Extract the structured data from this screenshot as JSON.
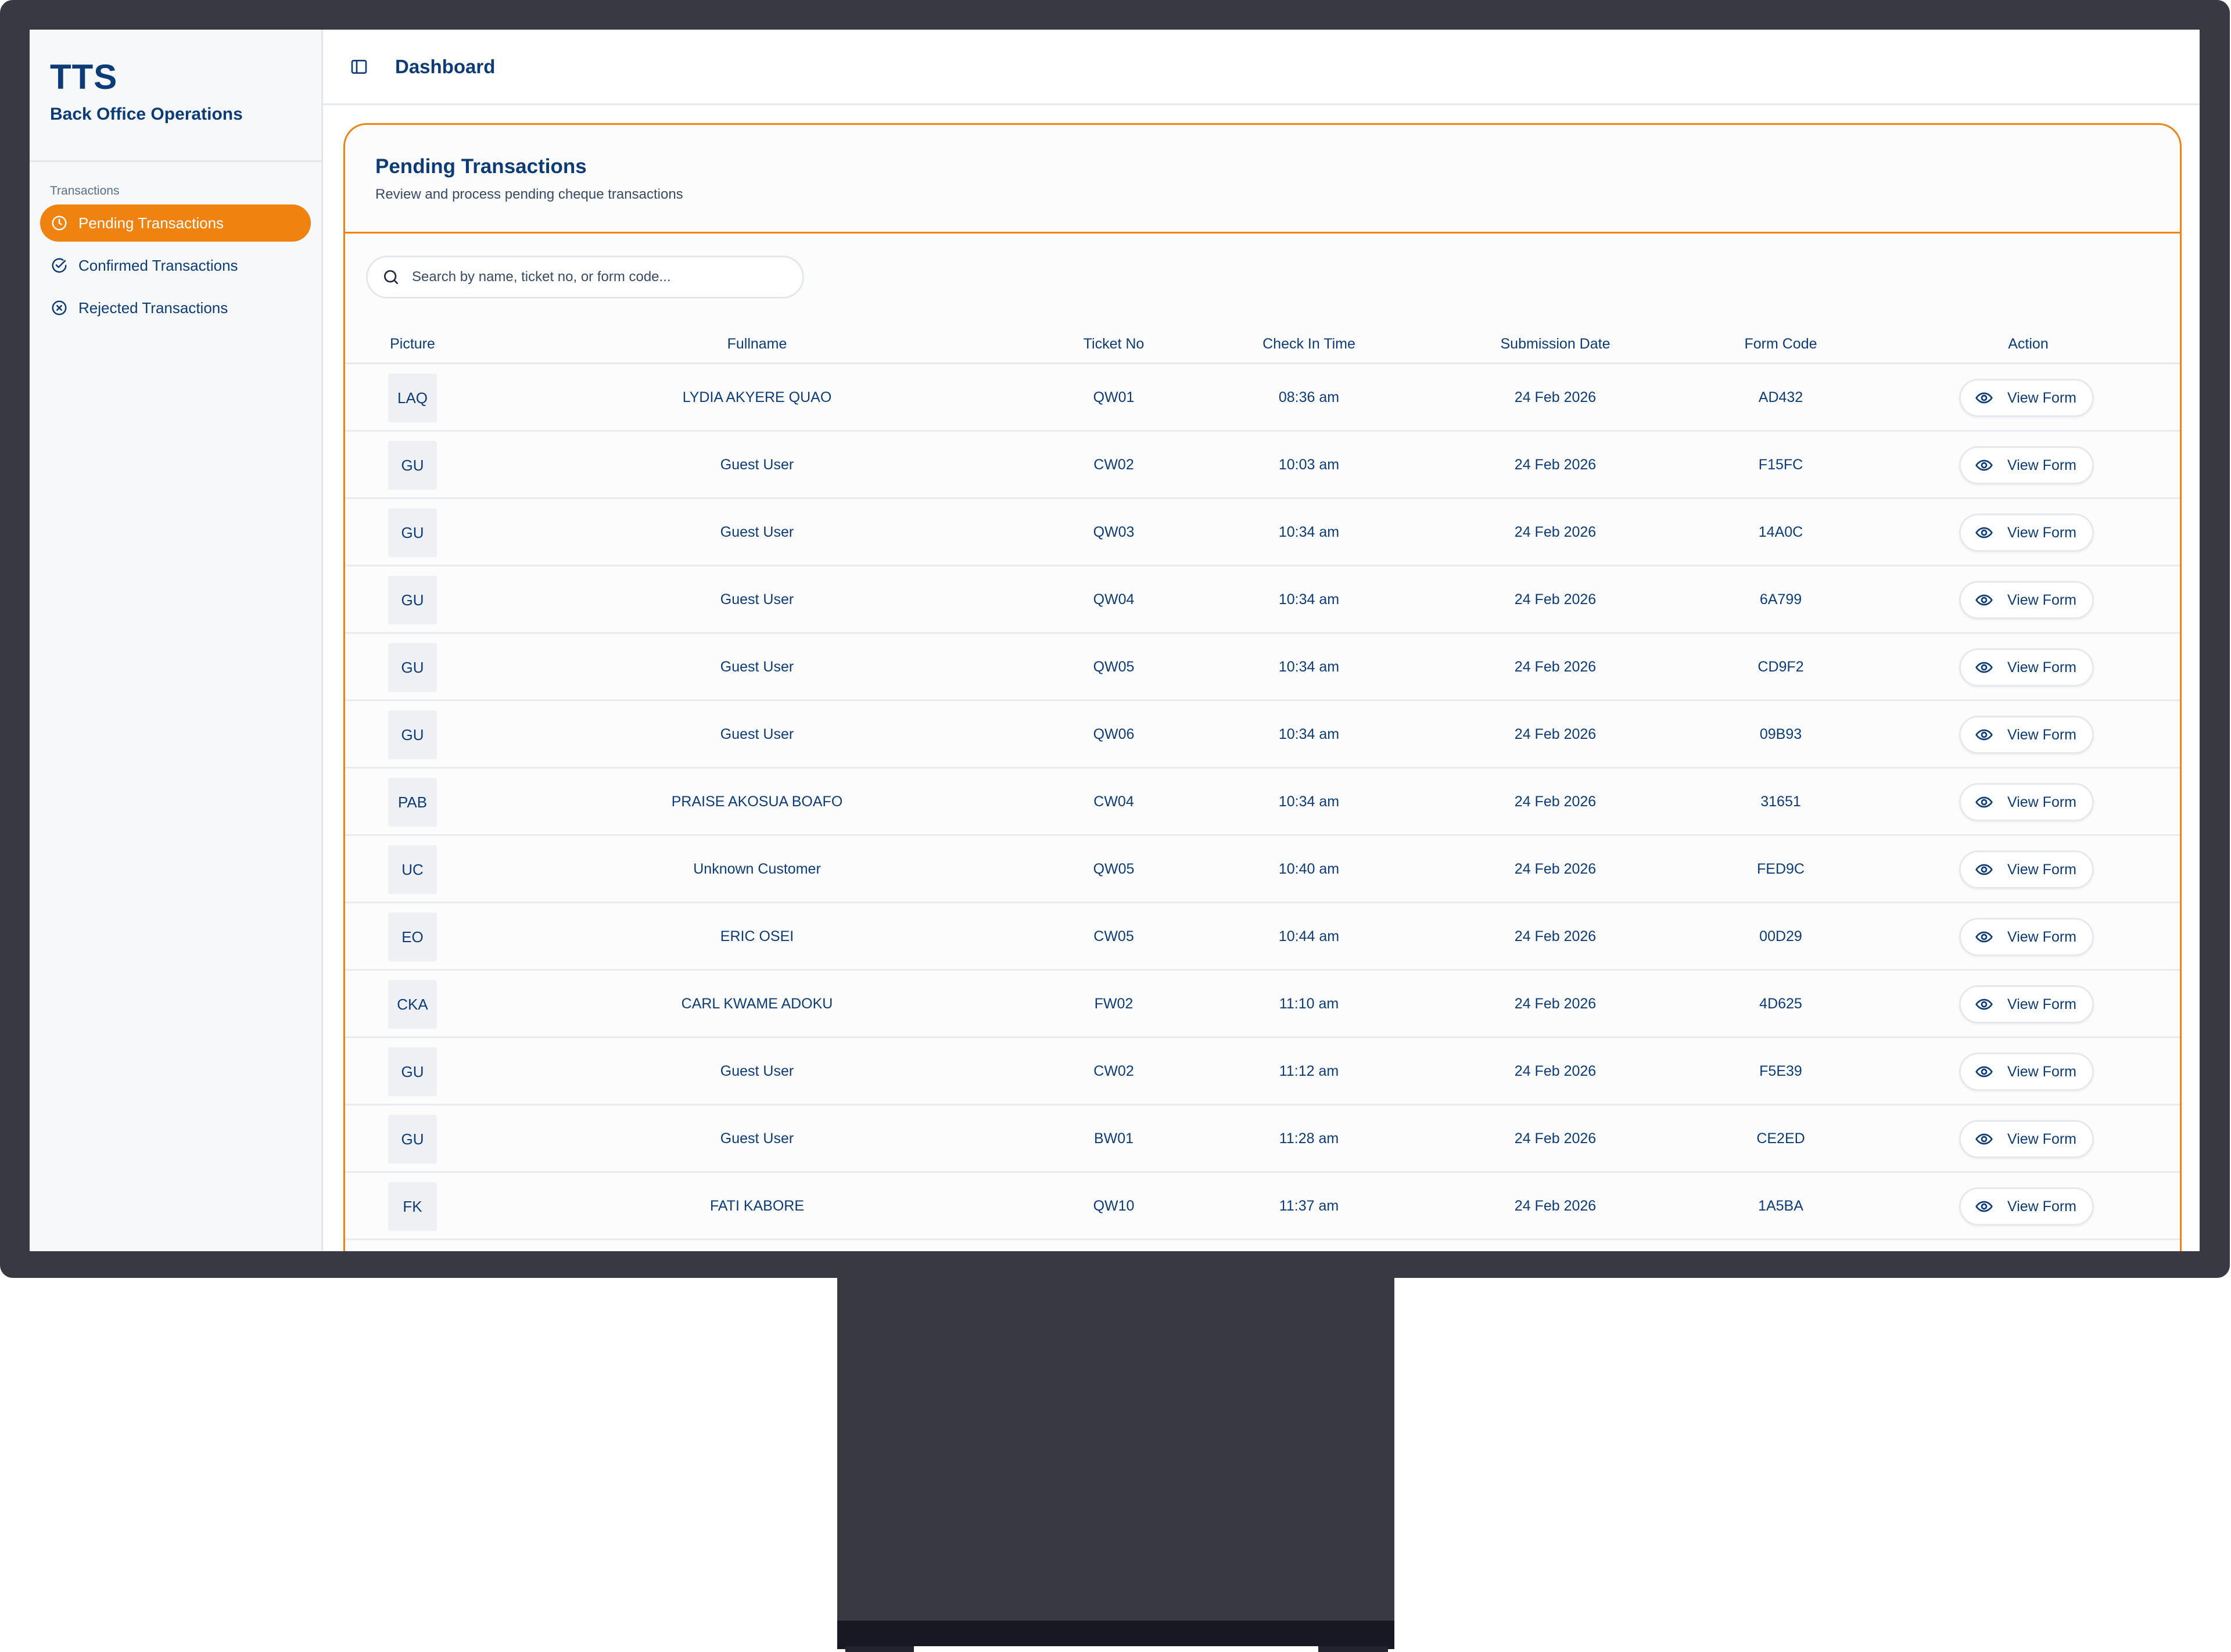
{
  "sidebar": {
    "brand_title": "TTS",
    "brand_subtitle": "Back Office Operations",
    "group_label": "Transactions",
    "items": [
      {
        "label": "Pending Transactions",
        "icon": "clock-icon",
        "active": true
      },
      {
        "label": "Confirmed Transactions",
        "icon": "check-circle-icon",
        "active": false
      },
      {
        "label": "Rejected Transactions",
        "icon": "x-circle-icon",
        "active": false
      }
    ]
  },
  "header": {
    "title": "Dashboard",
    "toggle_icon": "sidebar-toggle-icon"
  },
  "panel": {
    "title": "Pending Transactions",
    "subtitle": "Review and process pending cheque transactions",
    "search_placeholder": "Search by name, ticket no, or form code..."
  },
  "table": {
    "columns": [
      "Picture",
      "Fullname",
      "Ticket No",
      "Check In Time",
      "Submission Date",
      "Form Code",
      "Action"
    ],
    "action_label": "View Form",
    "action_icon": "eye-icon",
    "rows": [
      {
        "initials": "LAQ",
        "fullname": "LYDIA AKYERE QUAO",
        "ticket": "QW01",
        "checkin": "08:36 am",
        "date": "24 Feb 2026",
        "code": "AD432"
      },
      {
        "initials": "GU",
        "fullname": "Guest User",
        "ticket": "CW02",
        "checkin": "10:03 am",
        "date": "24 Feb 2026",
        "code": "F15FC"
      },
      {
        "initials": "GU",
        "fullname": "Guest User",
        "ticket": "QW03",
        "checkin": "10:34 am",
        "date": "24 Feb 2026",
        "code": "14A0C"
      },
      {
        "initials": "GU",
        "fullname": "Guest User",
        "ticket": "QW04",
        "checkin": "10:34 am",
        "date": "24 Feb 2026",
        "code": "6A799"
      },
      {
        "initials": "GU",
        "fullname": "Guest User",
        "ticket": "QW05",
        "checkin": "10:34 am",
        "date": "24 Feb 2026",
        "code": "CD9F2"
      },
      {
        "initials": "GU",
        "fullname": "Guest User",
        "ticket": "QW06",
        "checkin": "10:34 am",
        "date": "24 Feb 2026",
        "code": "09B93"
      },
      {
        "initials": "PAB",
        "fullname": "PRAISE AKOSUA BOAFO",
        "ticket": "CW04",
        "checkin": "10:34 am",
        "date": "24 Feb 2026",
        "code": "31651"
      },
      {
        "initials": "UC",
        "fullname": "Unknown Customer",
        "ticket": "QW05",
        "checkin": "10:40 am",
        "date": "24 Feb 2026",
        "code": "FED9C"
      },
      {
        "initials": "EO",
        "fullname": "ERIC OSEI",
        "ticket": "CW05",
        "checkin": "10:44 am",
        "date": "24 Feb 2026",
        "code": "00D29"
      },
      {
        "initials": "CKA",
        "fullname": "CARL KWAME ADOKU",
        "ticket": "FW02",
        "checkin": "11:10 am",
        "date": "24 Feb 2026",
        "code": "4D625"
      },
      {
        "initials": "GU",
        "fullname": "Guest User",
        "ticket": "CW02",
        "checkin": "11:12 am",
        "date": "24 Feb 2026",
        "code": "F5E39"
      },
      {
        "initials": "GU",
        "fullname": "Guest User",
        "ticket": "BW01",
        "checkin": "11:28 am",
        "date": "24 Feb 2026",
        "code": "CE2ED"
      },
      {
        "initials": "FK",
        "fullname": "FATI KABORE",
        "ticket": "QW10",
        "checkin": "11:37 am",
        "date": "24 Feb 2026",
        "code": "1A5BA"
      }
    ]
  },
  "colors": {
    "accent": "#f0820f",
    "text_primary": "#0d3b78",
    "monitor_frame": "#383942"
  }
}
